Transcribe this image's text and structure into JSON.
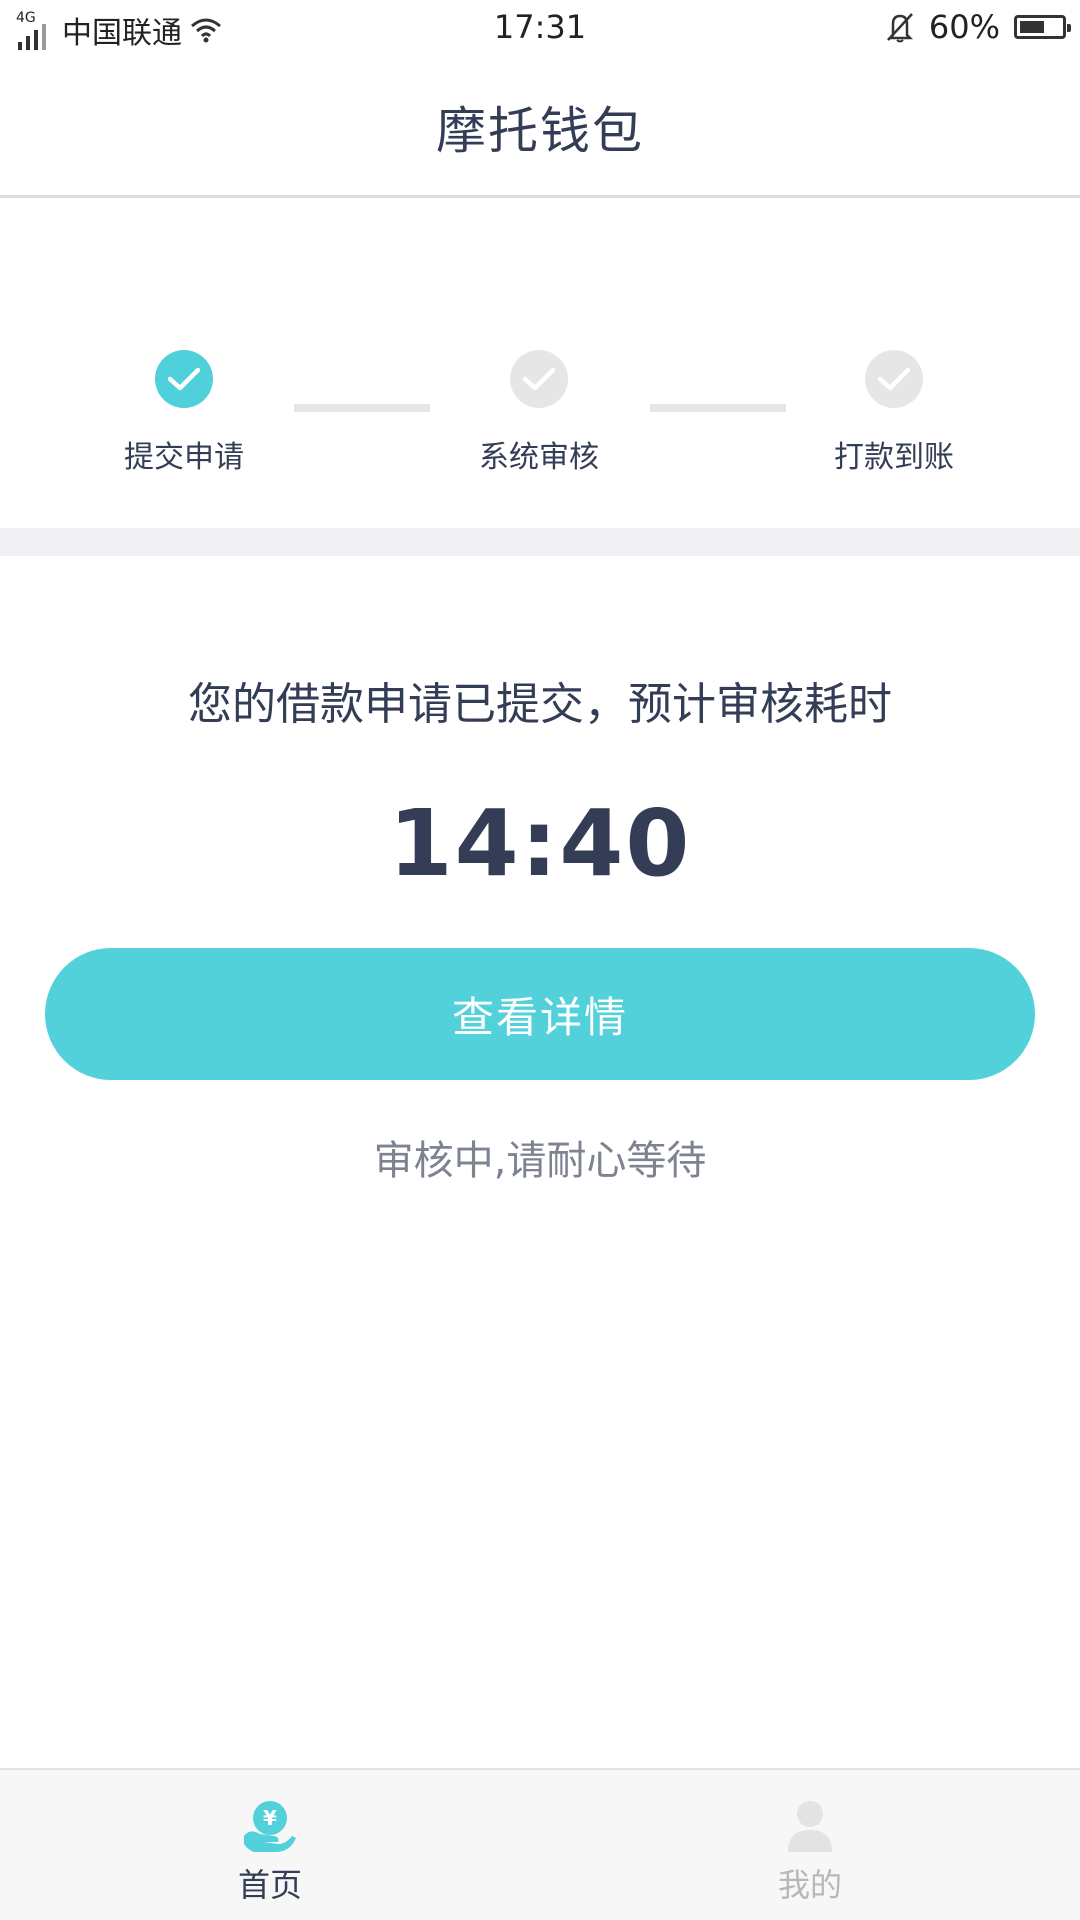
{
  "status_bar": {
    "network": "4G",
    "carrier": "中国联通",
    "time": "17:31",
    "battery": "60%",
    "battery_level": 0.6
  },
  "header": {
    "title": "摩托钱包"
  },
  "steps": [
    {
      "label": "提交申请",
      "state": "done"
    },
    {
      "label": "系统审核",
      "state": "pending"
    },
    {
      "label": "打款到账",
      "state": "pending"
    }
  ],
  "main": {
    "message": "您的借款申请已提交，预计审核耗时",
    "timer": "14:40",
    "details_button": "查看详情",
    "wait_text": "审核中,请耐心等待"
  },
  "tabs": [
    {
      "label": "首页",
      "icon": "wallet-hand-icon",
      "active": true
    },
    {
      "label": "我的",
      "icon": "user-icon",
      "active": false
    }
  ],
  "colors": {
    "accent": "#52d1db",
    "text_dark": "#333d55",
    "text_muted": "#7d8391",
    "inactive": "#e6e6e6"
  }
}
